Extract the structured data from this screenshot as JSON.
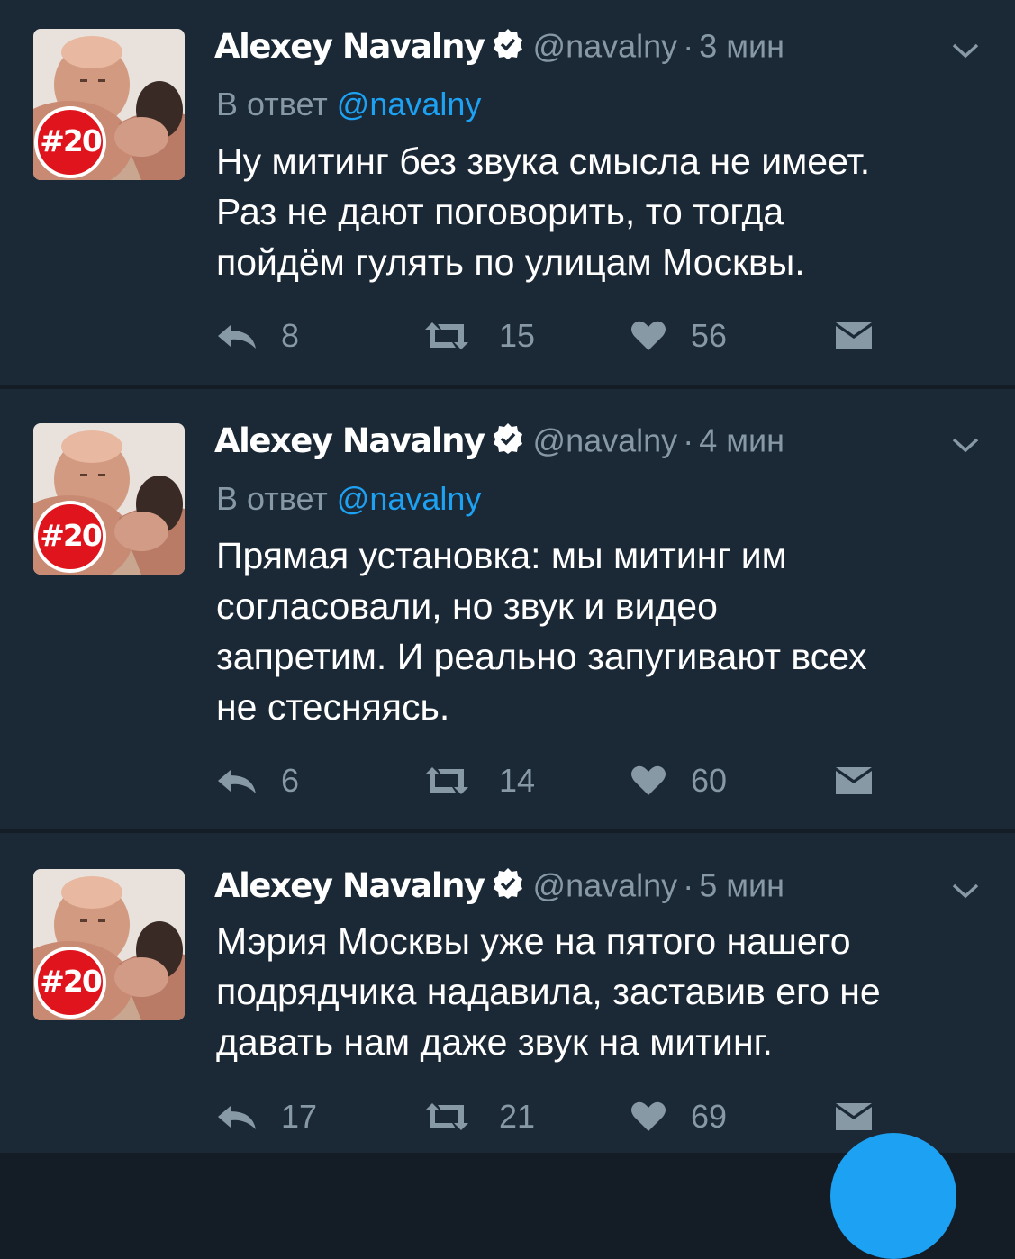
{
  "colors": {
    "background": "#141d26",
    "card": "#1b2836",
    "text": "#ffffff",
    "muted": "#8899a6",
    "link": "#1da1f2",
    "badge": "#e0141c"
  },
  "avatar": {
    "badge": "#20"
  },
  "tweets": [
    {
      "author": "Alexey Navalny",
      "handle": "@navalny",
      "separator": "·",
      "time": "3 мин",
      "reply_prefix": "В ответ",
      "reply_to": "@navalny",
      "lines": [
        "Ну митинг без звука смысла не имеет.",
        "Раз не дают поговорить, то тогда",
        "пойдём гулять по улицам Москвы."
      ],
      "replies": "8",
      "retweets": "15",
      "likes": "56"
    },
    {
      "author": "Alexey Navalny",
      "handle": "@navalny",
      "separator": "·",
      "time": "4 мин",
      "reply_prefix": "В ответ",
      "reply_to": "@navalny",
      "lines": [
        "Прямая установка: мы митинг им",
        "согласовали, но звук и видео",
        "запретим. И реально запугивают всех",
        "не стесняясь."
      ],
      "replies": "6",
      "retweets": "14",
      "likes": "60"
    },
    {
      "author": "Alexey Navalny",
      "handle": "@navalny",
      "separator": "·",
      "time": "5 мин",
      "lines": [
        "Мэрия Москвы уже на пятого нашего",
        "подрядчика надавила, заставив его не",
        "давать нам даже звук на митинг."
      ],
      "replies": "17",
      "retweets": "21",
      "likes": "69"
    }
  ]
}
